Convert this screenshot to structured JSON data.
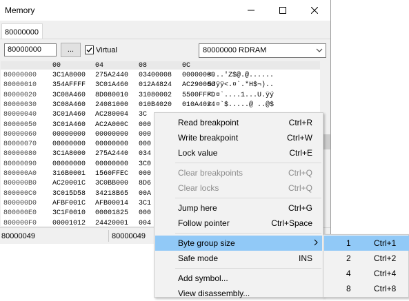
{
  "window": {
    "title": "Memory",
    "controls": {
      "minimize": "—",
      "maximize": "☐",
      "close": "✕"
    }
  },
  "tab": {
    "label": "80000000"
  },
  "toolbar": {
    "address_value": "80000000",
    "browse_label": "...",
    "virtual_label": "Virtual",
    "virtual_checked": true,
    "region_selected": "80000000 RDRAM"
  },
  "memory": {
    "column_headers": [
      "00",
      "04",
      "08",
      "0C"
    ],
    "rows": [
      {
        "addr": "80000000",
        "cells": [
          "3C1A8000",
          "275A2440",
          "03400008",
          "00000000"
        ],
        "ascii": "<...'Z$@.@......"
      },
      {
        "addr": "80000010",
        "cells": [
          "354AFFFF",
          "3C01A460",
          "012A4824",
          "AC290000"
        ],
        "ascii": "5Jÿÿ<.¤`.*H$¬)..",
        "hide_ascii": false
      },
      {
        "addr": "80000020",
        "cells": [
          "3C08A460",
          "8D080010",
          "31080002",
          "5500FFFD"
        ],
        "ascii": "<.¤`....1...U.ÿý"
      },
      {
        "addr": "80000030",
        "cells": [
          "3C08A460",
          "24081000",
          "010B4020",
          "010A4024"
        ],
        "ascii": "<.¤`$.....@ ..@$"
      },
      {
        "addr": "80000040",
        "cells": [
          "3C01A460",
          "AC280004",
          "3C",
          ""
        ],
        "ascii": ""
      },
      {
        "addr": "80000050",
        "cells": [
          "3C01A460",
          "AC2A000C",
          "000",
          ""
        ],
        "ascii": ""
      },
      {
        "addr": "80000060",
        "cells": [
          "00000000",
          "00000000",
          "000",
          ""
        ],
        "ascii": ""
      },
      {
        "addr": "80000070",
        "cells": [
          "00000000",
          "00000000",
          "000",
          ""
        ],
        "ascii": ""
      },
      {
        "addr": "80000080",
        "cells": [
          "3C1A8000",
          "275A2440",
          "034",
          ""
        ],
        "ascii": ""
      },
      {
        "addr": "80000090",
        "cells": [
          "00000000",
          "00000000",
          "3C0",
          ""
        ],
        "ascii": ""
      },
      {
        "addr": "800000A0",
        "cells": [
          "316B0001",
          "1560FFEC",
          "000",
          ""
        ],
        "ascii": ""
      },
      {
        "addr": "800000B0",
        "cells": [
          "AC20001C",
          "3C0BB000",
          "8D6",
          ""
        ],
        "ascii": ""
      },
      {
        "addr": "800000C0",
        "cells": [
          "3C015D58",
          "34218B65",
          "00A",
          ""
        ],
        "ascii": ""
      },
      {
        "addr": "800000D0",
        "cells": [
          "AFBF001C",
          "AFB00014",
          "3C1",
          ""
        ],
        "ascii": ""
      },
      {
        "addr": "800000E0",
        "cells": [
          "3C1F0010",
          "00001825",
          "000",
          ""
        ],
        "ascii": ""
      },
      {
        "addr": "800000F0",
        "cells": [
          "00001012",
          "24420001",
          "004",
          ""
        ],
        "ascii": ""
      }
    ]
  },
  "status": {
    "left": "80000049",
    "middle": "80000049"
  },
  "context_menu": {
    "items": [
      {
        "label": "Read breakpoint",
        "shortcut": "Ctrl+R"
      },
      {
        "label": "Write breakpoint",
        "shortcut": "Ctrl+W"
      },
      {
        "label": "Lock value",
        "shortcut": "Ctrl+E"
      },
      {
        "label": "Clear breakpoints",
        "shortcut": "Ctrl+Q"
      },
      {
        "label": "Clear locks",
        "shortcut": "Ctrl+Q"
      },
      {
        "label": "Jump here",
        "shortcut": "Ctrl+G"
      },
      {
        "label": "Follow pointer",
        "shortcut": "Ctrl+Space"
      },
      {
        "label": "Byte group size",
        "submenu_arrow": "›"
      },
      {
        "label": "Safe mode",
        "shortcut": "INS"
      },
      {
        "label": "Add symbol..."
      },
      {
        "label": "View disassembly..."
      }
    ]
  },
  "submenu": {
    "items": [
      {
        "label": "1",
        "shortcut": "Ctrl+1"
      },
      {
        "label": "2",
        "shortcut": "Ctrl+2"
      },
      {
        "label": "4",
        "shortcut": "Ctrl+4"
      },
      {
        "label": "8",
        "shortcut": "Ctrl+8"
      }
    ]
  },
  "colors": {
    "highlight": "#91c9f7",
    "disabled_text": "#8d8d8d"
  }
}
